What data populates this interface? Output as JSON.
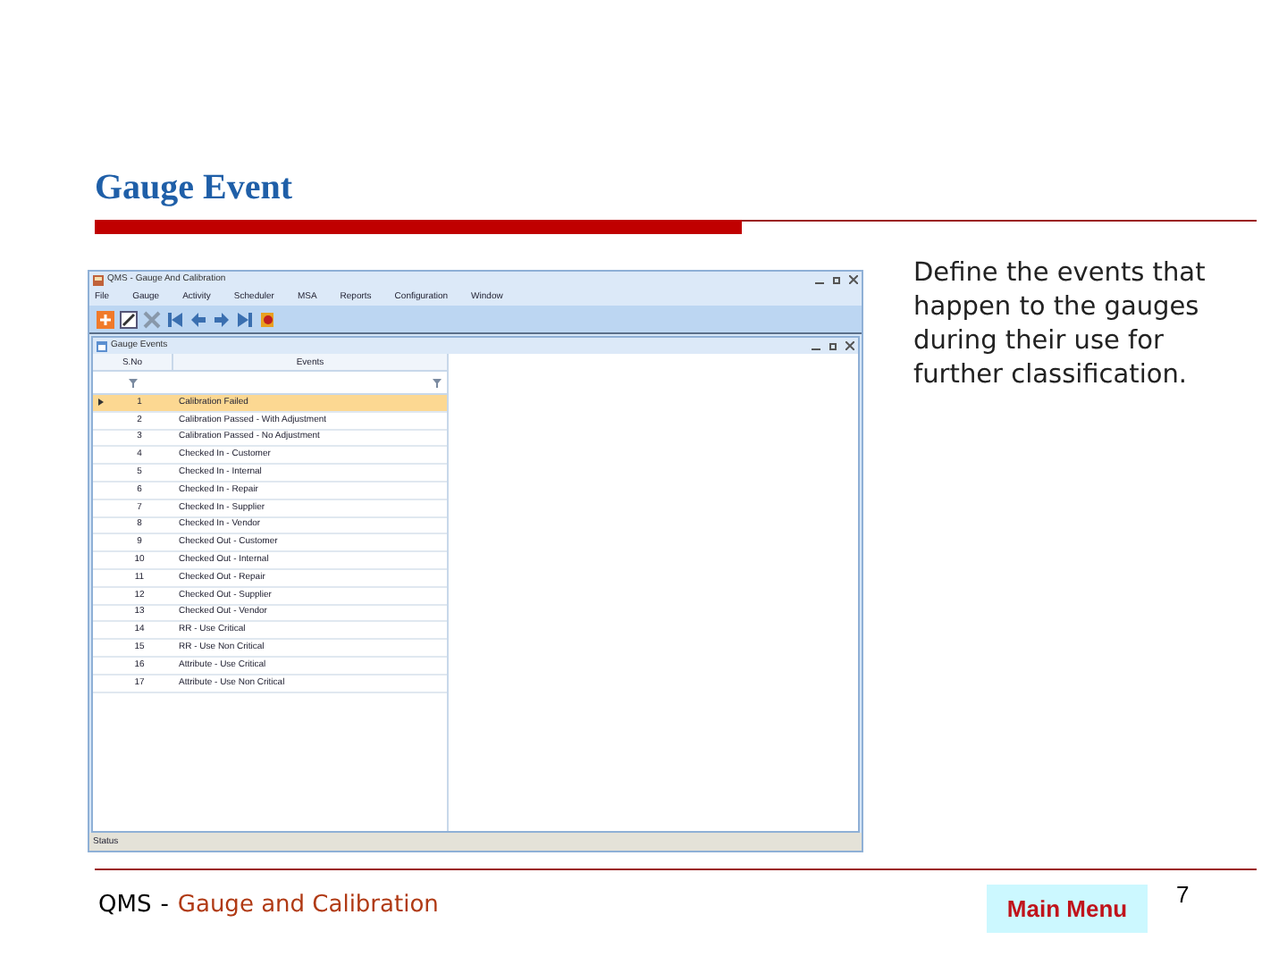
{
  "slide_title": "Gauge Event",
  "app": {
    "title": "QMS - Gauge And Calibration",
    "menu": [
      "File",
      "Gauge",
      "Activity",
      "Scheduler",
      "MSA",
      "Reports",
      "Configuration",
      "Window"
    ],
    "child_window": {
      "title": "Gauge Events",
      "columns": [
        "S.No",
        "Events"
      ],
      "rows": [
        {
          "no": "1",
          "event": "Calibration Failed",
          "selected": true
        },
        {
          "no": "2",
          "event": "Calibration Passed - With Adjustment",
          "selected": false
        },
        {
          "no": "3",
          "event": "Calibration Passed - No Adjustment",
          "selected": false
        },
        {
          "no": "4",
          "event": "Checked In - Customer",
          "selected": false
        },
        {
          "no": "5",
          "event": "Checked In - Internal",
          "selected": false
        },
        {
          "no": "6",
          "event": "Checked In - Repair",
          "selected": false
        },
        {
          "no": "7",
          "event": "Checked In - Supplier",
          "selected": false
        },
        {
          "no": "8",
          "event": "Checked In - Vendor",
          "selected": false
        },
        {
          "no": "9",
          "event": "Checked Out - Customer",
          "selected": false
        },
        {
          "no": "10",
          "event": "Checked Out - Internal",
          "selected": false
        },
        {
          "no": "11",
          "event": "Checked Out - Repair",
          "selected": false
        },
        {
          "no": "12",
          "event": "Checked Out - Supplier",
          "selected": false
        },
        {
          "no": "13",
          "event": "Checked Out - Vendor",
          "selected": false
        },
        {
          "no": "14",
          "event": "RR - Use Critical",
          "selected": false
        },
        {
          "no": "15",
          "event": "RR - Use Non Critical",
          "selected": false
        },
        {
          "no": "16",
          "event": "Attribute - Use Critical",
          "selected": false
        },
        {
          "no": "17",
          "event": "Attribute - Use Non Critical",
          "selected": false
        }
      ]
    },
    "status_bar": "Status"
  },
  "description": "Define the events that happen to the gauges during their use for further classification.",
  "footer": {
    "prefix": "QMS",
    "separator": "-",
    "title": "Gauge and Calibration"
  },
  "main_menu_button": "Main Menu",
  "page_number": "7"
}
